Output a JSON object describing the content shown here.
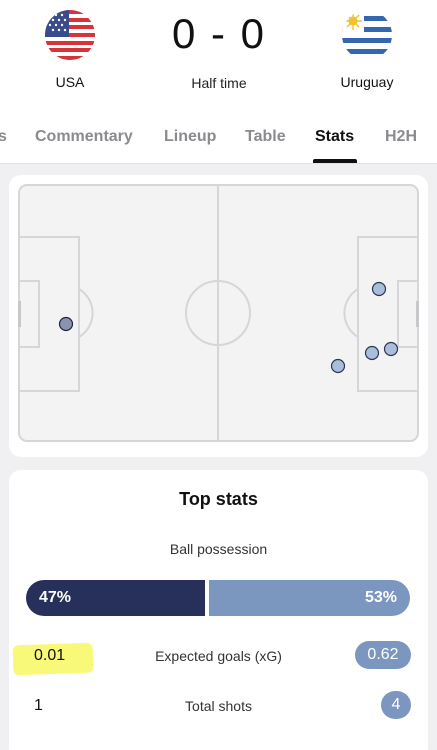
{
  "match": {
    "home_team": "USA",
    "away_team": "Uruguay",
    "score": "0 - 0",
    "status": "Half time"
  },
  "tabs": [
    {
      "label": "s",
      "active": false
    },
    {
      "label": "Commentary",
      "active": false
    },
    {
      "label": "Lineup",
      "active": false
    },
    {
      "label": "Table",
      "active": false
    },
    {
      "label": "Stats",
      "active": true
    },
    {
      "label": "H2H",
      "active": false
    }
  ],
  "shot_map": {
    "home_shots": 1,
    "away_shots": 4
  },
  "top_stats": {
    "title": "Top stats",
    "possession": {
      "label": "Ball possession",
      "home": "47%",
      "away": "53%",
      "home_value": 47,
      "away_value": 53
    },
    "rows": [
      {
        "label": "Expected goals (xG)",
        "home": "0.01",
        "away": "0.62"
      },
      {
        "label": "Total shots",
        "home": "1",
        "away": "4"
      }
    ]
  },
  "colors": {
    "home": "#27305a",
    "away": "#7b97c0",
    "pitch": "#f3f3f4",
    "pitch_lines": "#d6d6d8",
    "highlight": "#f7f74c"
  }
}
